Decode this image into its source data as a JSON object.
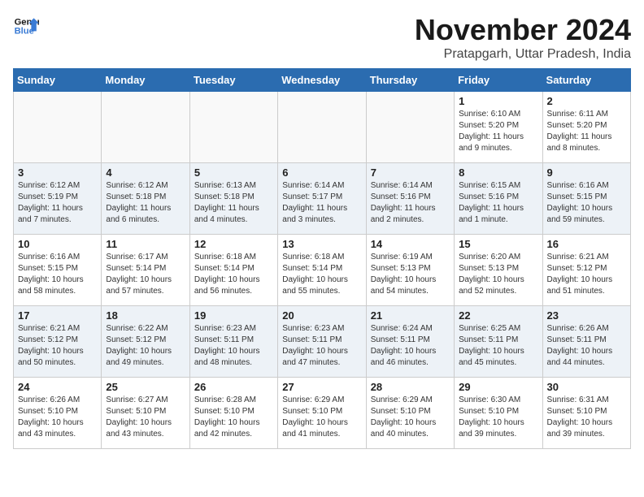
{
  "logo": {
    "line1": "General",
    "line2": "Blue"
  },
  "title": "November 2024",
  "location": "Pratapgarh, Uttar Pradesh, India",
  "days_header": [
    "Sunday",
    "Monday",
    "Tuesday",
    "Wednesday",
    "Thursday",
    "Friday",
    "Saturday"
  ],
  "weeks": [
    [
      {
        "day": "",
        "info": ""
      },
      {
        "day": "",
        "info": ""
      },
      {
        "day": "",
        "info": ""
      },
      {
        "day": "",
        "info": ""
      },
      {
        "day": "",
        "info": ""
      },
      {
        "day": "1",
        "info": "Sunrise: 6:10 AM\nSunset: 5:20 PM\nDaylight: 11 hours and 9 minutes."
      },
      {
        "day": "2",
        "info": "Sunrise: 6:11 AM\nSunset: 5:20 PM\nDaylight: 11 hours and 8 minutes."
      }
    ],
    [
      {
        "day": "3",
        "info": "Sunrise: 6:12 AM\nSunset: 5:19 PM\nDaylight: 11 hours and 7 minutes."
      },
      {
        "day": "4",
        "info": "Sunrise: 6:12 AM\nSunset: 5:18 PM\nDaylight: 11 hours and 6 minutes."
      },
      {
        "day": "5",
        "info": "Sunrise: 6:13 AM\nSunset: 5:18 PM\nDaylight: 11 hours and 4 minutes."
      },
      {
        "day": "6",
        "info": "Sunrise: 6:14 AM\nSunset: 5:17 PM\nDaylight: 11 hours and 3 minutes."
      },
      {
        "day": "7",
        "info": "Sunrise: 6:14 AM\nSunset: 5:16 PM\nDaylight: 11 hours and 2 minutes."
      },
      {
        "day": "8",
        "info": "Sunrise: 6:15 AM\nSunset: 5:16 PM\nDaylight: 11 hours and 1 minute."
      },
      {
        "day": "9",
        "info": "Sunrise: 6:16 AM\nSunset: 5:15 PM\nDaylight: 10 hours and 59 minutes."
      }
    ],
    [
      {
        "day": "10",
        "info": "Sunrise: 6:16 AM\nSunset: 5:15 PM\nDaylight: 10 hours and 58 minutes."
      },
      {
        "day": "11",
        "info": "Sunrise: 6:17 AM\nSunset: 5:14 PM\nDaylight: 10 hours and 57 minutes."
      },
      {
        "day": "12",
        "info": "Sunrise: 6:18 AM\nSunset: 5:14 PM\nDaylight: 10 hours and 56 minutes."
      },
      {
        "day": "13",
        "info": "Sunrise: 6:18 AM\nSunset: 5:14 PM\nDaylight: 10 hours and 55 minutes."
      },
      {
        "day": "14",
        "info": "Sunrise: 6:19 AM\nSunset: 5:13 PM\nDaylight: 10 hours and 54 minutes."
      },
      {
        "day": "15",
        "info": "Sunrise: 6:20 AM\nSunset: 5:13 PM\nDaylight: 10 hours and 52 minutes."
      },
      {
        "day": "16",
        "info": "Sunrise: 6:21 AM\nSunset: 5:12 PM\nDaylight: 10 hours and 51 minutes."
      }
    ],
    [
      {
        "day": "17",
        "info": "Sunrise: 6:21 AM\nSunset: 5:12 PM\nDaylight: 10 hours and 50 minutes."
      },
      {
        "day": "18",
        "info": "Sunrise: 6:22 AM\nSunset: 5:12 PM\nDaylight: 10 hours and 49 minutes."
      },
      {
        "day": "19",
        "info": "Sunrise: 6:23 AM\nSunset: 5:11 PM\nDaylight: 10 hours and 48 minutes."
      },
      {
        "day": "20",
        "info": "Sunrise: 6:23 AM\nSunset: 5:11 PM\nDaylight: 10 hours and 47 minutes."
      },
      {
        "day": "21",
        "info": "Sunrise: 6:24 AM\nSunset: 5:11 PM\nDaylight: 10 hours and 46 minutes."
      },
      {
        "day": "22",
        "info": "Sunrise: 6:25 AM\nSunset: 5:11 PM\nDaylight: 10 hours and 45 minutes."
      },
      {
        "day": "23",
        "info": "Sunrise: 6:26 AM\nSunset: 5:11 PM\nDaylight: 10 hours and 44 minutes."
      }
    ],
    [
      {
        "day": "24",
        "info": "Sunrise: 6:26 AM\nSunset: 5:10 PM\nDaylight: 10 hours and 43 minutes."
      },
      {
        "day": "25",
        "info": "Sunrise: 6:27 AM\nSunset: 5:10 PM\nDaylight: 10 hours and 43 minutes."
      },
      {
        "day": "26",
        "info": "Sunrise: 6:28 AM\nSunset: 5:10 PM\nDaylight: 10 hours and 42 minutes."
      },
      {
        "day": "27",
        "info": "Sunrise: 6:29 AM\nSunset: 5:10 PM\nDaylight: 10 hours and 41 minutes."
      },
      {
        "day": "28",
        "info": "Sunrise: 6:29 AM\nSunset: 5:10 PM\nDaylight: 10 hours and 40 minutes."
      },
      {
        "day": "29",
        "info": "Sunrise: 6:30 AM\nSunset: 5:10 PM\nDaylight: 10 hours and 39 minutes."
      },
      {
        "day": "30",
        "info": "Sunrise: 6:31 AM\nSunset: 5:10 PM\nDaylight: 10 hours and 39 minutes."
      }
    ]
  ]
}
